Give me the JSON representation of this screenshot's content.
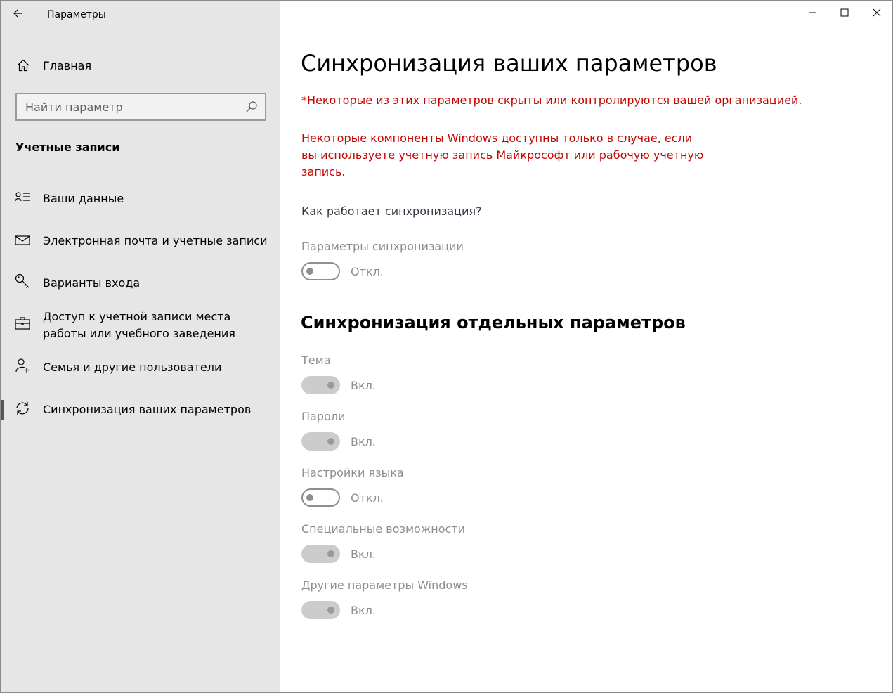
{
  "window": {
    "title": "Параметры"
  },
  "sidebar": {
    "home_label": "Главная",
    "search_placeholder": "Найти параметр",
    "section_title": "Учетные записи",
    "items": [
      {
        "label": "Ваши данные",
        "icon": "person-card-icon"
      },
      {
        "label": "Электронная почта и учетные записи",
        "icon": "mail-icon"
      },
      {
        "label": "Варианты входа",
        "icon": "key-icon"
      },
      {
        "label": "Доступ к учетной записи места работы или учебного заведения",
        "icon": "briefcase-icon"
      },
      {
        "label": "Семья и другие пользователи",
        "icon": "add-person-icon"
      },
      {
        "label": "Синхронизация ваших параметров",
        "icon": "sync-icon",
        "active": true
      }
    ]
  },
  "main": {
    "title": "Синхронизация ваших параметров",
    "warning_org": "*Некоторые из этих параметров скрыты или контролируются вашей организацией.",
    "warning_account": "Некоторые компоненты Windows доступны только в случае, если вы используете учетную запись Майкрософт или рабочую учетную запись.",
    "how_link": "Как работает синхронизация?",
    "sync_settings": {
      "label": "Параметры синхронизации",
      "state": "Откл.",
      "on": false
    },
    "individual_title": "Синхронизация отдельных параметров",
    "individual": [
      {
        "label": "Тема",
        "state": "Вкл.",
        "on": true
      },
      {
        "label": "Пароли",
        "state": "Вкл.",
        "on": true
      },
      {
        "label": "Настройки языка",
        "state": "Откл.",
        "on": false
      },
      {
        "label": "Специальные возможности",
        "state": "Вкл.",
        "on": true
      },
      {
        "label": "Другие параметры Windows",
        "state": "Вкл.",
        "on": true
      }
    ]
  },
  "colors": {
    "warning": "#c50500",
    "disabled_text": "#8e8e8e",
    "sidebar_bg": "#e6e6e6"
  }
}
